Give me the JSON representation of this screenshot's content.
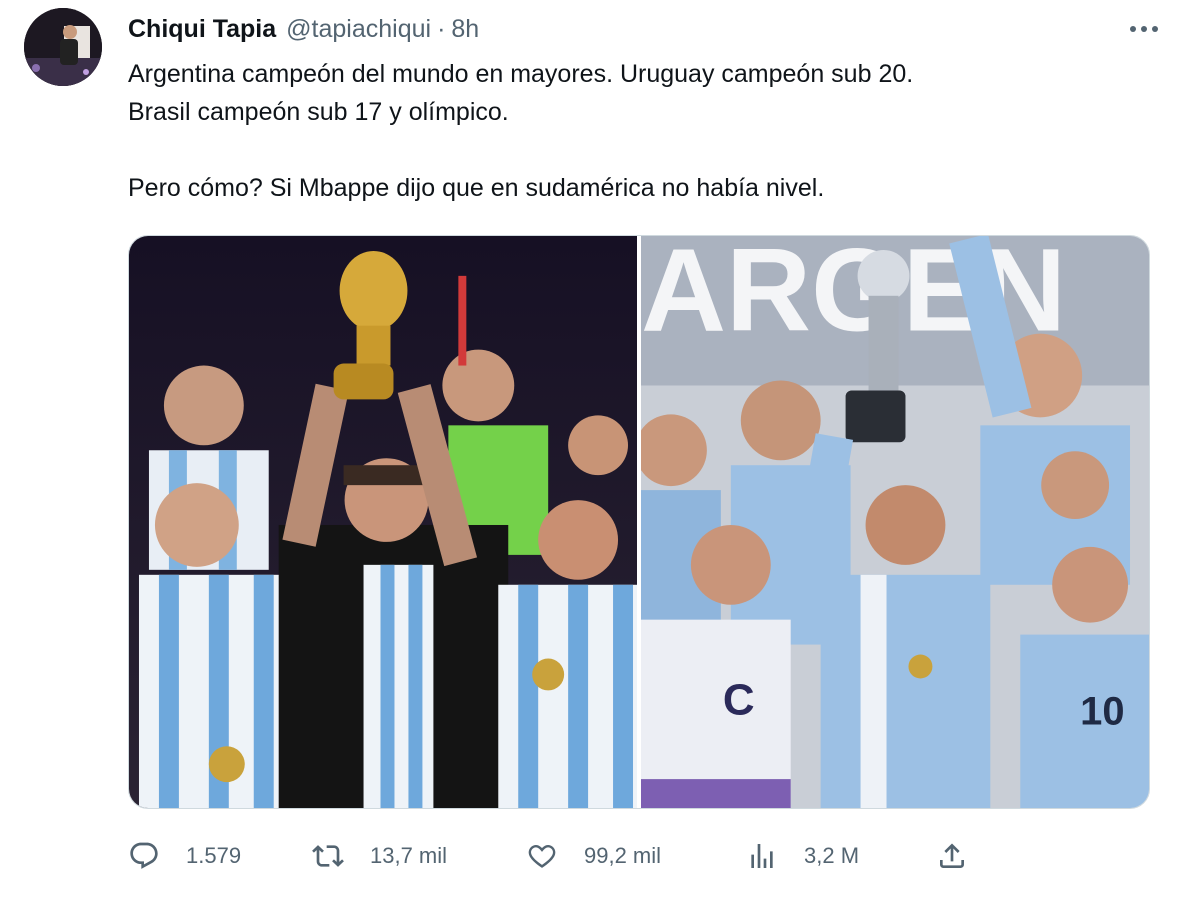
{
  "author": {
    "name": "Chiqui Tapia",
    "handle": "@tapiachiqui",
    "separator": "·",
    "time": "8h"
  },
  "tweet": {
    "line1": "Argentina campeón del mundo en mayores. Uruguay campeón sub 20.",
    "line2": "Brasil campeón sub 17 y olímpico.",
    "line3": "Pero cómo? Si Mbappe dijo que en sudamérica no había nivel."
  },
  "media": {
    "right_banner_text": "ARGEN",
    "jersey_letter": "C",
    "jersey_number": "10"
  },
  "actions": {
    "replies": "1.579",
    "retweets": "13,7 mil",
    "likes": "99,2 mil",
    "views": "3,2 M"
  },
  "icons": {
    "more": "more-icon",
    "reply": "reply-icon",
    "retweet": "retweet-icon",
    "like": "heart-icon",
    "views": "views-icon",
    "share": "share-icon"
  },
  "colors": {
    "text": "#0f1419",
    "secondary": "#536471",
    "border": "#cfd9de"
  }
}
